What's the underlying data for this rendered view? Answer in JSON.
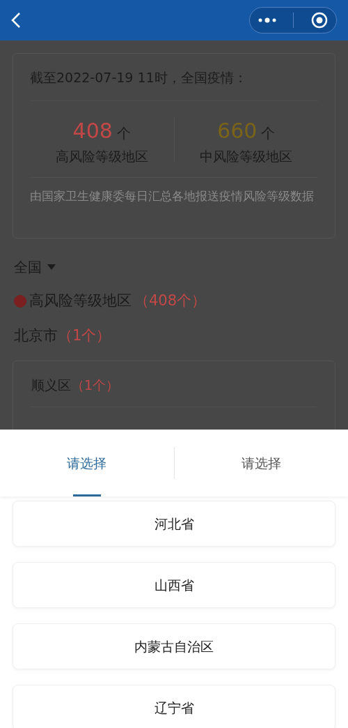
{
  "summary": {
    "title": "截至2022-07-19 11时，全国疫情：",
    "stats": [
      {
        "number": "408",
        "unit": "个",
        "label": "高风险等级地区",
        "color": "#c24848"
      },
      {
        "number": "660",
        "unit": "个",
        "label": "中风险等级地区",
        "color": "#7a6419"
      }
    ],
    "note": "由国家卫生健康委每日汇总各地报送疫情风险等级数据"
  },
  "scope": {
    "label": "全国"
  },
  "level_heading": {
    "label": "高风险等级地区",
    "count": "（408个）"
  },
  "groups": [
    {
      "city": "北京市",
      "count": "（1个）",
      "districts": [
        {
          "name": "顺义区",
          "count": "（1个）"
        }
      ]
    }
  ],
  "picker": {
    "tabs": [
      {
        "label": "请选择",
        "selected": true
      },
      {
        "label": "请选择",
        "selected": false
      }
    ],
    "options": [
      "河北省",
      "山西省",
      "内蒙古自治区",
      "辽宁省"
    ]
  }
}
